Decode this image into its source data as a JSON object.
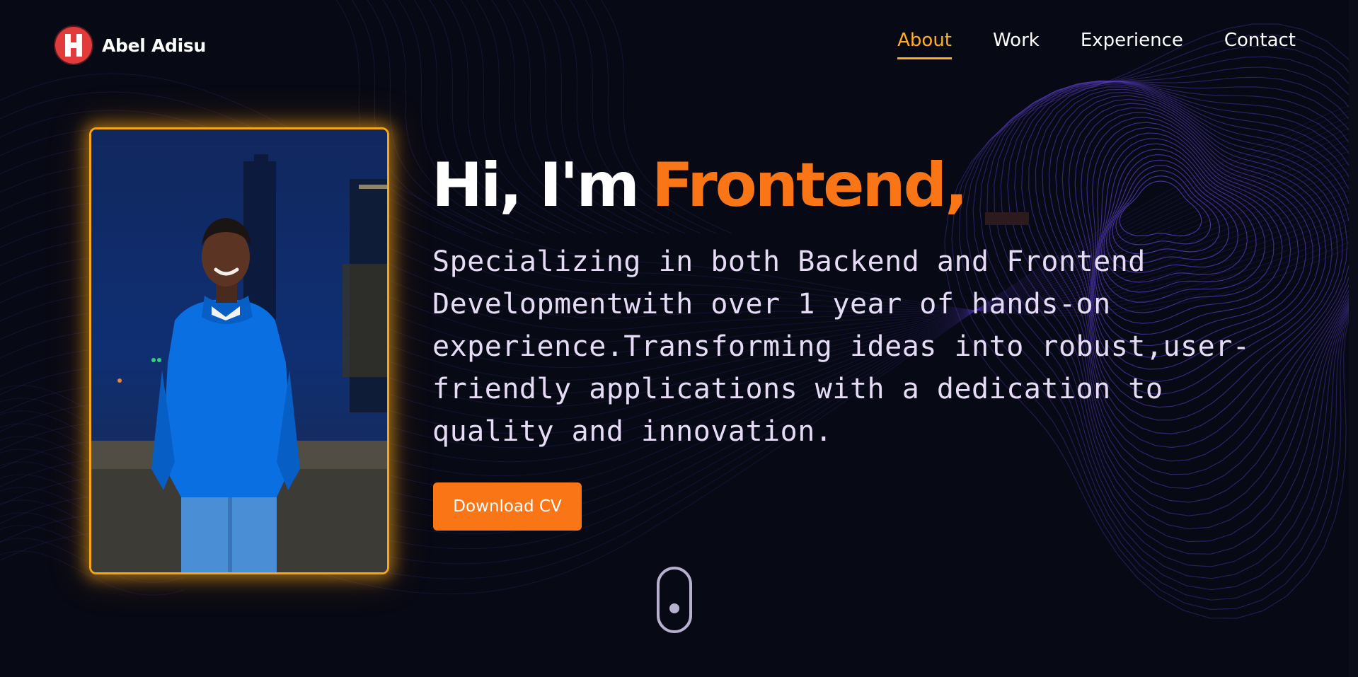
{
  "brand": {
    "name": "Abel Adisu",
    "logo_icon": "h-letter-logo-icon",
    "logo_color": "#e23b3b"
  },
  "nav": {
    "items": [
      {
        "label": "About",
        "active": true
      },
      {
        "label": "Work",
        "active": false
      },
      {
        "label": "Experience",
        "active": false
      },
      {
        "label": "Contact",
        "active": false
      }
    ],
    "active_color": "#ffb020"
  },
  "hero": {
    "greeting": "Hi, I'm",
    "role": "Frontend,",
    "description": "Specializing in both Backend and Frontend Developmentwith over 1 year of hands-on experience.Transforming ideas into robust,user-friendly applications with a dedication to quality and innovation.",
    "cta_label": "Download CV",
    "accent_color": "#f97516",
    "photo_frame_color": "#f5a516"
  },
  "scroll_indicator": {
    "icon": "mouse-scroll-icon"
  },
  "theme": {
    "background": "#070914",
    "wave_color": "#5b3fc4"
  }
}
